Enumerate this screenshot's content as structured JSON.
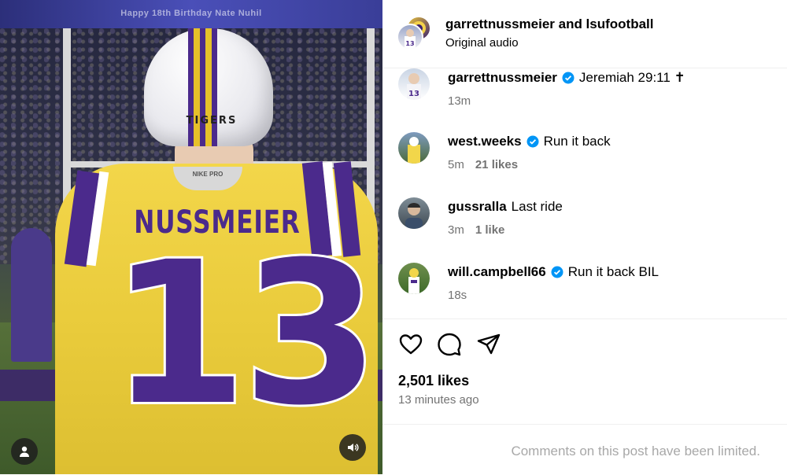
{
  "media": {
    "banner_text": "Happy 18th Birthday Nate Nuhil",
    "helmet_text": "TIGERS",
    "collar_text": "NIKE PRO",
    "jersey_name": "NUSSMEIER",
    "jersey_number": "13",
    "colors": {
      "purple": "#4b2a8c",
      "gold": "#f3d64a"
    }
  },
  "header": {
    "title": "garrettnussmeier and lsufootball",
    "subtitle": "Original audio"
  },
  "comments": [
    {
      "user": "garrettnussmeier",
      "verified": true,
      "text": "Jeremiah 29:11 ✝",
      "time": "13m",
      "likes": ""
    },
    {
      "user": "west.weeks",
      "verified": true,
      "text": "Run it back",
      "time": "5m",
      "likes": "21 likes"
    },
    {
      "user": "gussralla",
      "verified": false,
      "text": "Last ride",
      "time": "3m",
      "likes": "1 like"
    },
    {
      "user": "will.campbell66",
      "verified": true,
      "text": "Run it back BIL",
      "time": "18s",
      "likes": ""
    }
  ],
  "actions": {
    "icons": [
      "heart-icon",
      "comment-icon",
      "share-icon"
    ]
  },
  "post": {
    "likes": "2,501 likes",
    "time": "13 minutes ago"
  },
  "footer": {
    "limited_text": "Comments on this post have been limited."
  },
  "ui_colors": {
    "verified": "#0095f6",
    "secondary_text": "#737373",
    "muted_text": "#a8a8a8"
  }
}
